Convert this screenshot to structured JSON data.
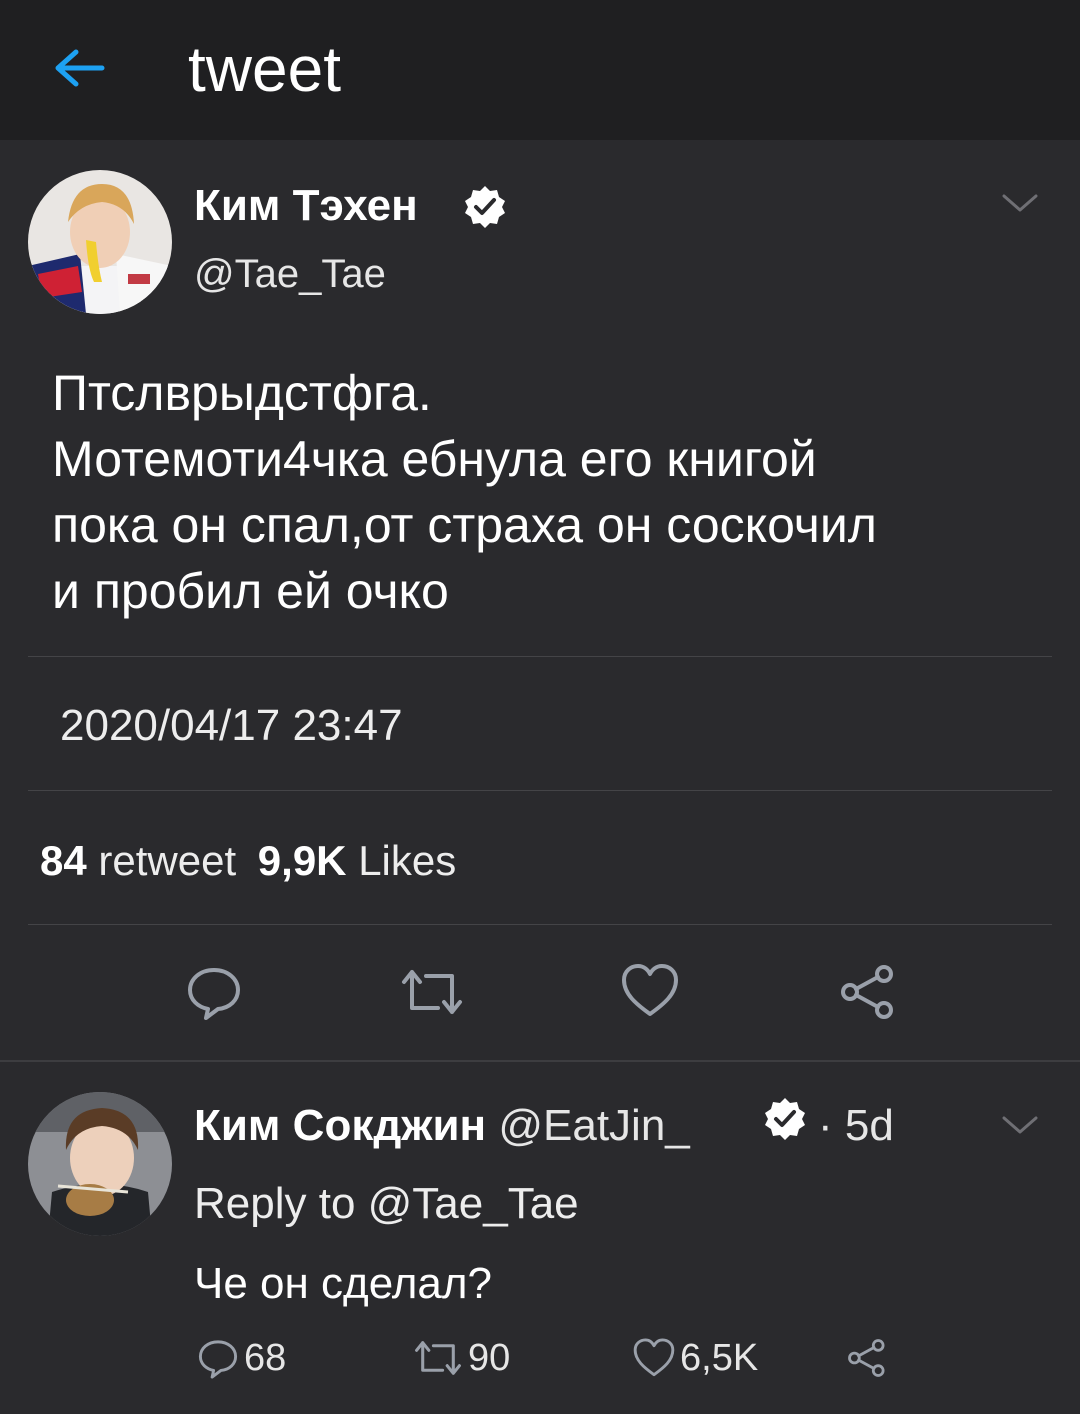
{
  "header": {
    "title": "tweet",
    "accent_color": "#1da1f2"
  },
  "tweet": {
    "author_name": "Ким Тэхен",
    "author_handle": "@Tae_Tae",
    "text_lines": [
      "Птслврыдстфга.",
      "Мотемоти4чка  ебнула его книгой",
      "пока он спал,от страха он соскочил",
      "и пробил ей очко"
    ],
    "timestamp": "2020/04/17 23:47",
    "retweets_count": "84",
    "retweets_label": "retweet",
    "likes_count": "9,9K",
    "likes_label": "Likes",
    "icons": [
      "reply-icon",
      "retweet-icon",
      "like-icon",
      "share-icon"
    ]
  },
  "reply": {
    "author_name": "Ким Сокджин",
    "author_handle": "@EatJin_",
    "separator": "·",
    "age": "5d",
    "reply_to": "Reply to @Tae_Tae",
    "text": "Че он сделал?",
    "reply_count": "68",
    "retweet_count": "90",
    "like_count": "6,5K"
  }
}
